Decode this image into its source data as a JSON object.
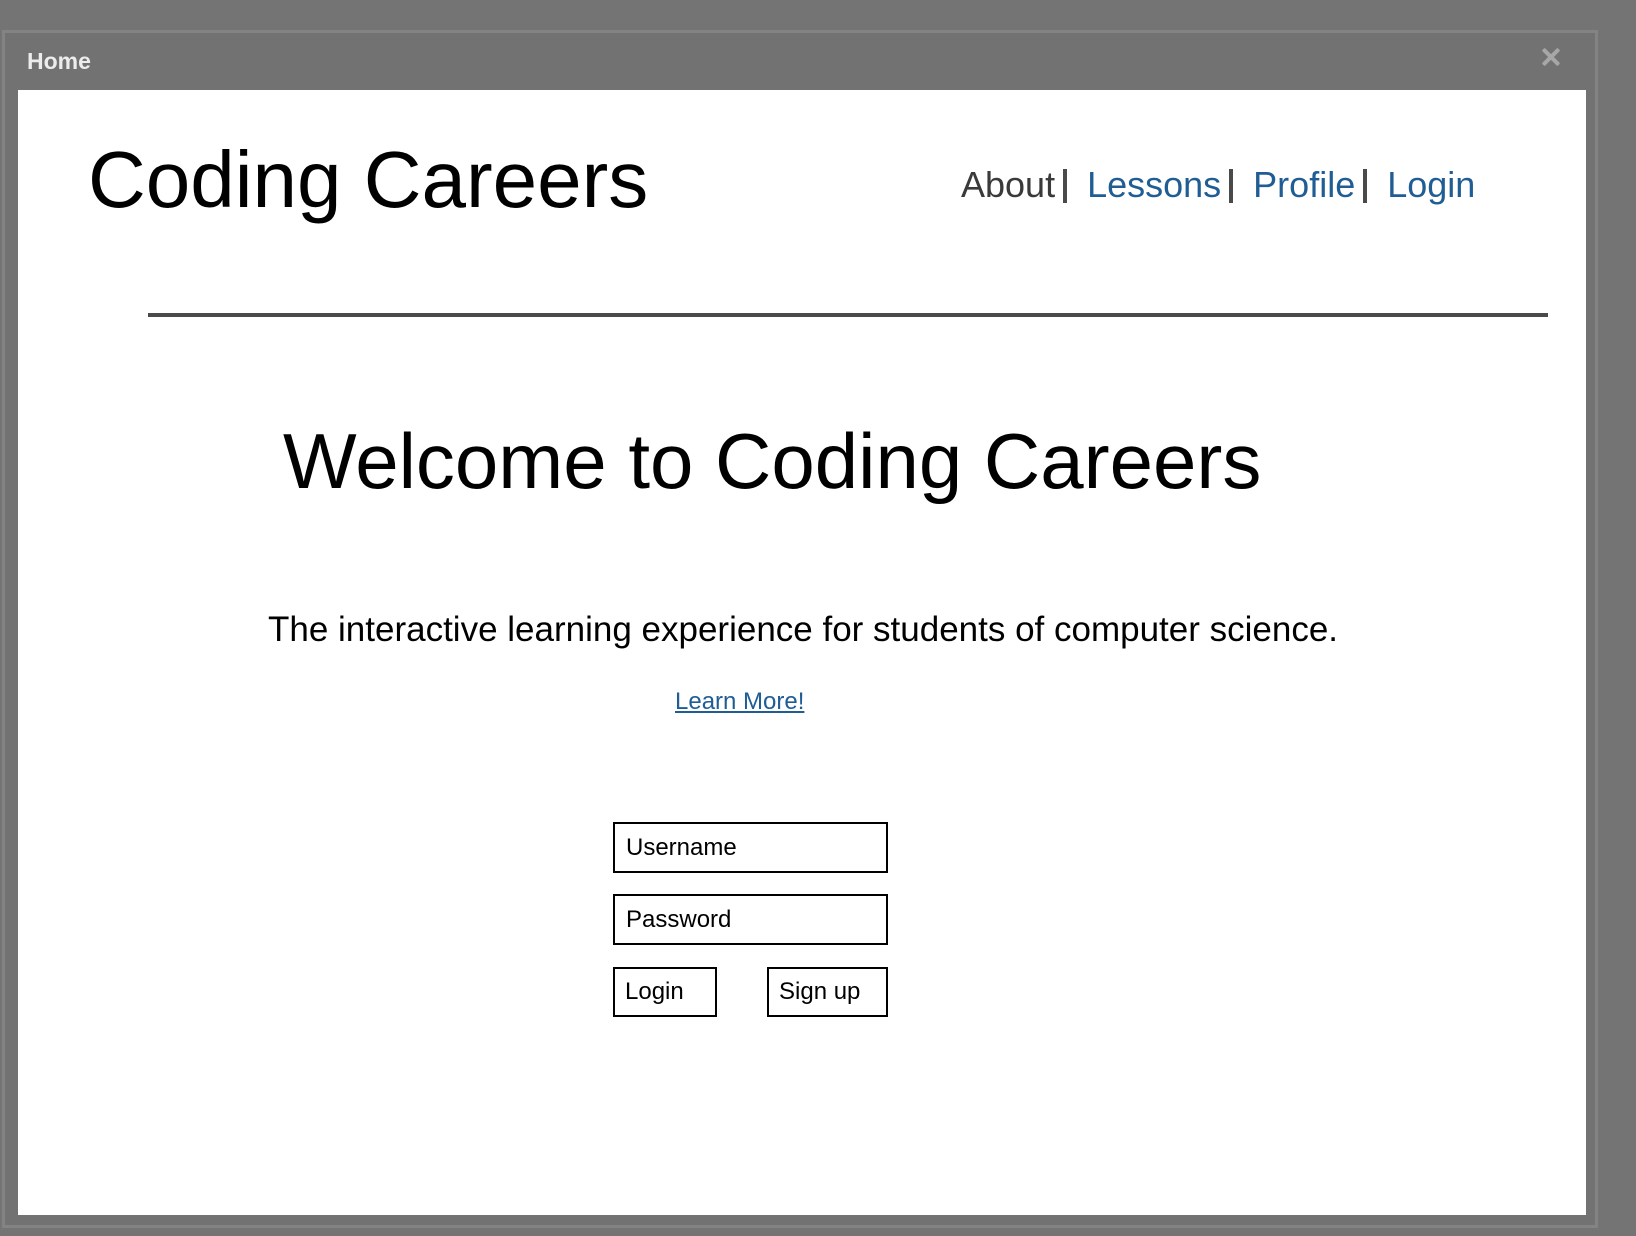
{
  "window": {
    "title": "Home",
    "close_icon": "close-icon"
  },
  "header": {
    "site_title": "Coding Careers",
    "nav": {
      "about": "About",
      "lessons": "Lessons",
      "profile": "Profile",
      "login": "Login"
    }
  },
  "hero": {
    "heading": "Welcome to Coding Careers",
    "tagline": "The interactive learning experience for students of computer science.",
    "learn_more": "Learn More!"
  },
  "login_form": {
    "username_placeholder": "Username",
    "password_placeholder": "Password",
    "login_button": "Login",
    "signup_button": "Sign up"
  },
  "colors": {
    "link": "#1f5d94",
    "window_chrome": "#727272",
    "content_background": "#ffffff"
  }
}
